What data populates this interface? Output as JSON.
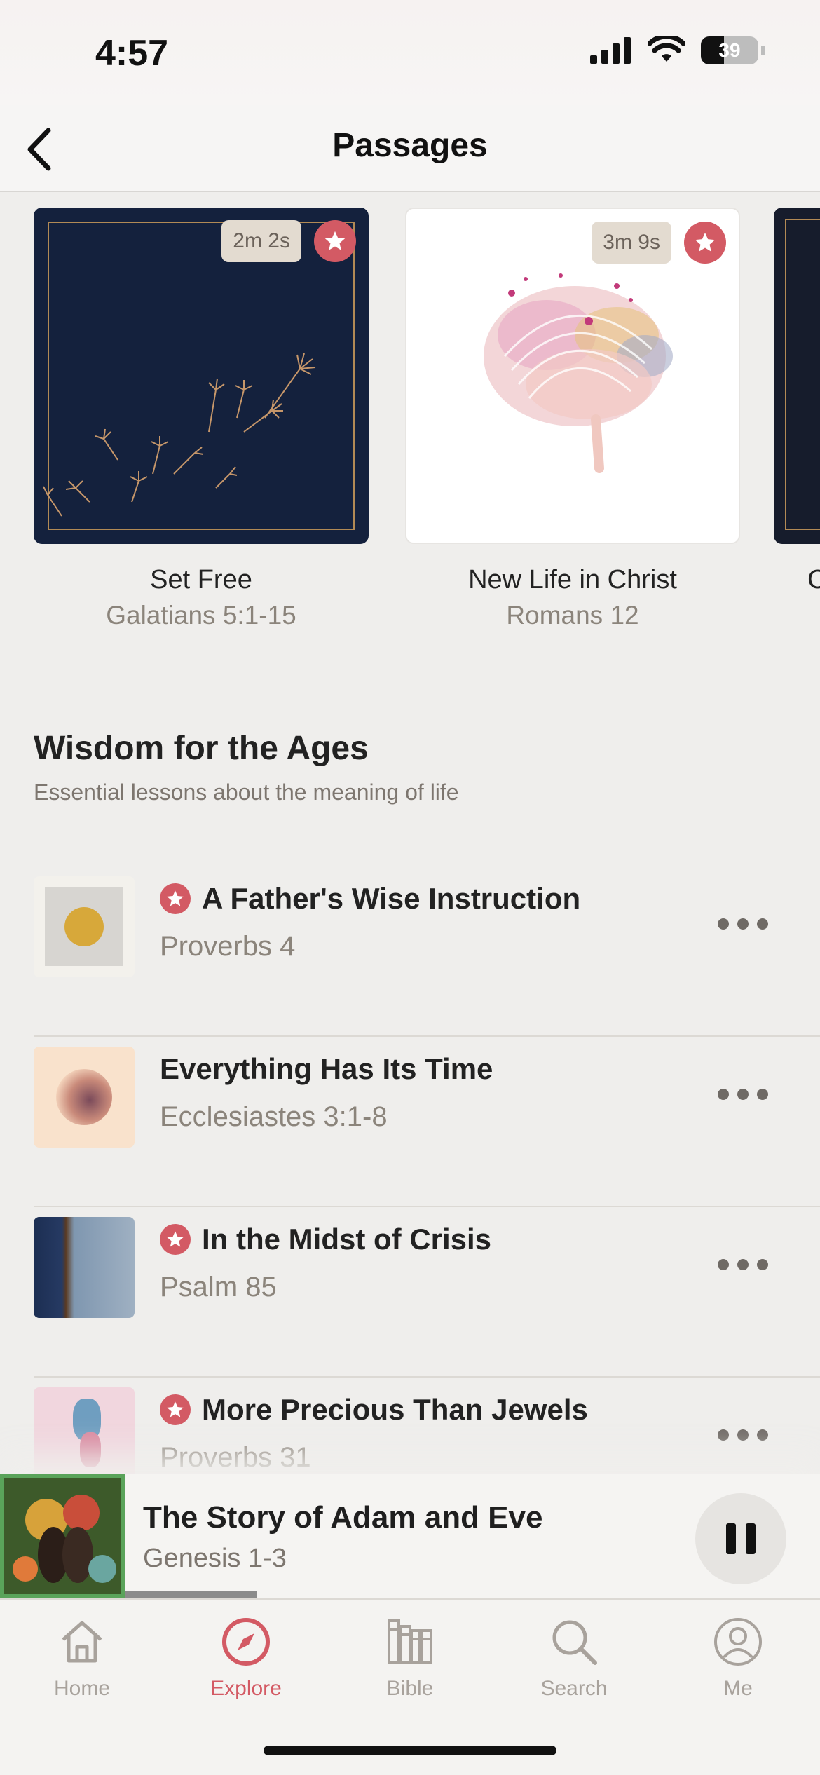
{
  "status": {
    "time": "4:57",
    "battery": "39"
  },
  "nav": {
    "title": "Passages"
  },
  "carousel": [
    {
      "title": "Set Free",
      "reference": "Galatians 5:1-15",
      "duration": "2m 2s",
      "art": "dandelion-seeds"
    },
    {
      "title": "New Life in Christ",
      "reference": "Romans 12",
      "duration": "3m 9s",
      "art": "fingerprint-brain"
    },
    {
      "title": "C",
      "reference": "",
      "duration": "",
      "art": "gold-frame"
    }
  ],
  "section": {
    "title": "Wisdom for the Ages",
    "subtitle": "Essential lessons about the meaning of life"
  },
  "list": [
    {
      "title": "A Father's Wise Instruction",
      "reference": "Proverbs 4",
      "starred": true
    },
    {
      "title": "Everything Has Its Time",
      "reference": "Ecclesiastes 3:1-8",
      "starred": false
    },
    {
      "title": "In the Midst of Crisis",
      "reference": "Psalm 85",
      "starred": true
    },
    {
      "title": "More Precious Than Jewels",
      "reference": "Proverbs 31",
      "starred": true
    }
  ],
  "now_playing": {
    "title": "The Story of Adam and Eve",
    "reference": "Genesis 1-3",
    "progress": 0.19
  },
  "tabs": [
    {
      "label": "Home",
      "icon": "home-icon"
    },
    {
      "label": "Explore",
      "icon": "compass-icon",
      "active": true
    },
    {
      "label": "Bible",
      "icon": "books-icon"
    },
    {
      "label": "Search",
      "icon": "search-icon"
    },
    {
      "label": "Me",
      "icon": "person-icon"
    }
  ],
  "colors": {
    "accent": "#d35a64",
    "background": "#efeeec",
    "navy": "#14213d"
  }
}
